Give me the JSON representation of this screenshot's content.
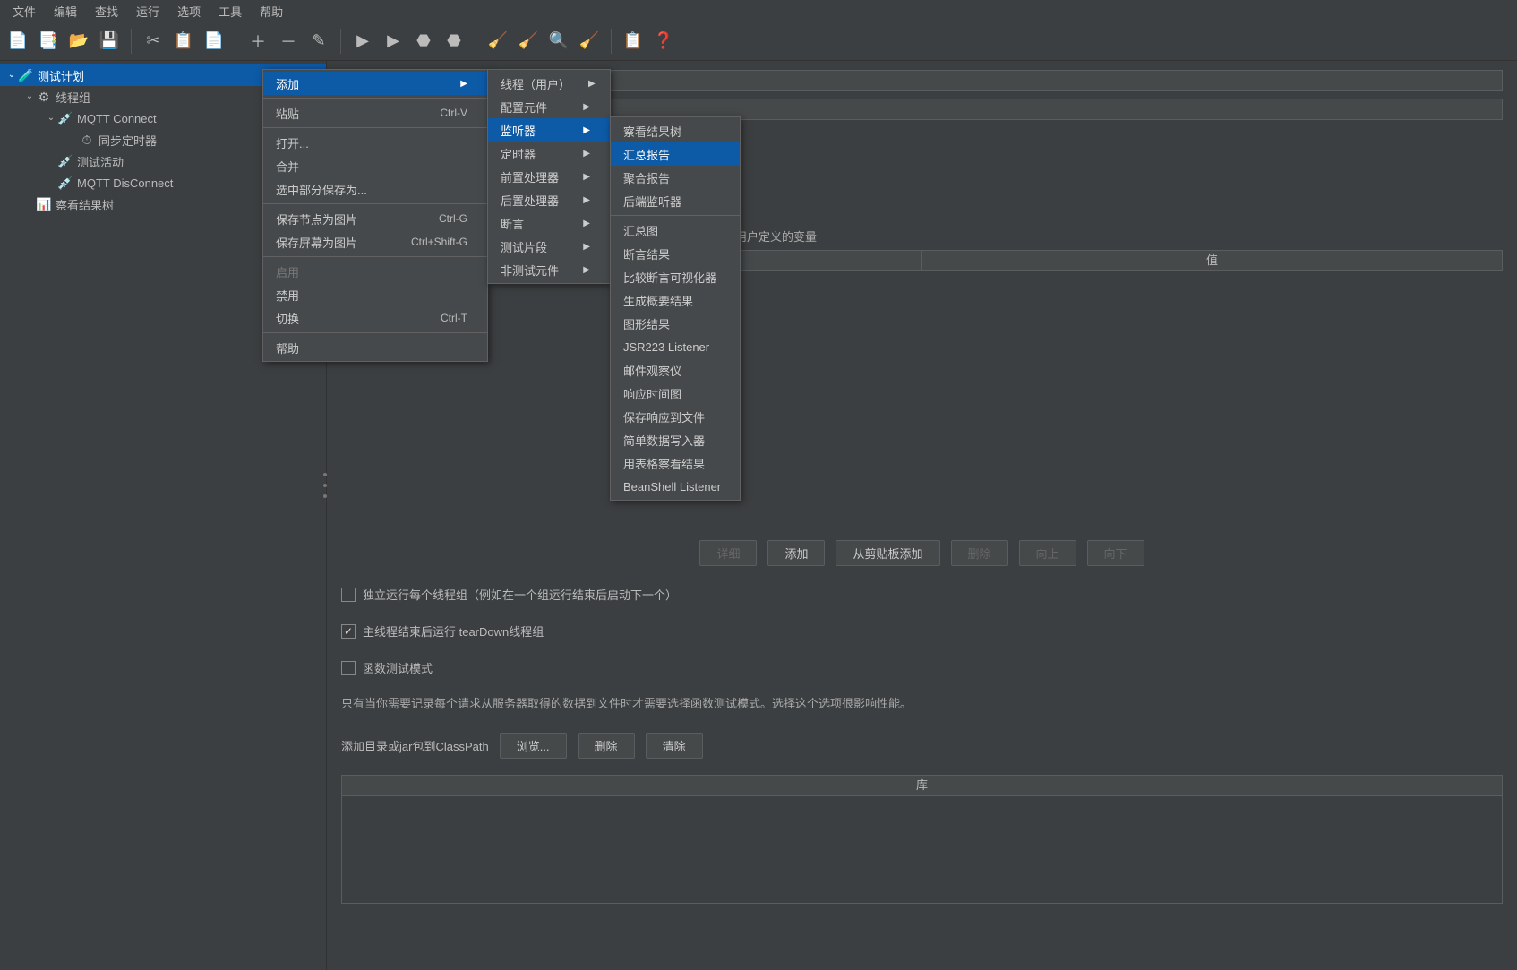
{
  "menubar": [
    "文件",
    "编辑",
    "查找",
    "运行",
    "选项",
    "工具",
    "帮助"
  ],
  "toolbar_icons": [
    {
      "name": "new-file-icon",
      "glyph": "📄"
    },
    {
      "name": "templates-icon",
      "glyph": "📑"
    },
    {
      "name": "open-icon",
      "glyph": "📂"
    },
    {
      "name": "save-icon",
      "glyph": "💾"
    },
    {
      "name": "sep"
    },
    {
      "name": "cut-icon",
      "glyph": "✂"
    },
    {
      "name": "copy-icon",
      "glyph": "📋"
    },
    {
      "name": "paste-icon",
      "glyph": "📄"
    },
    {
      "name": "sep"
    },
    {
      "name": "plus-icon",
      "glyph": "＋"
    },
    {
      "name": "minus-icon",
      "glyph": "－"
    },
    {
      "name": "wand-icon",
      "glyph": "✎"
    },
    {
      "name": "sep"
    },
    {
      "name": "run-icon",
      "glyph": "▶"
    },
    {
      "name": "run-remote-icon",
      "glyph": "▶"
    },
    {
      "name": "stop-icon",
      "glyph": "⬣"
    },
    {
      "name": "shutdown-icon",
      "glyph": "⬣"
    },
    {
      "name": "sep"
    },
    {
      "name": "clear-icon",
      "glyph": "🧹"
    },
    {
      "name": "clear-all-icon",
      "glyph": "🧹"
    },
    {
      "name": "search-icon",
      "glyph": "🔍"
    },
    {
      "name": "broom-icon",
      "glyph": "🧹"
    },
    {
      "name": "sep"
    },
    {
      "name": "func-icon",
      "glyph": "📋"
    },
    {
      "name": "help-icon",
      "glyph": "❓"
    }
  ],
  "tree": {
    "root": "测试计划",
    "thread_group": "线程组",
    "mqtt_connect": "MQTT Connect",
    "sync_timer": "同步定时器",
    "test_action": "测试活动",
    "mqtt_disconnect": "MQTT DisConnect",
    "view_results": "察看结果树"
  },
  "ctx1": {
    "add": "添加",
    "paste": "粘贴",
    "paste_sc": "Ctrl-V",
    "open": "打开...",
    "merge": "合并",
    "save_sel": "选中部分保存为...",
    "save_node_img": "保存节点为图片",
    "save_node_img_sc": "Ctrl-G",
    "save_screen_img": "保存屏幕为图片",
    "save_screen_img_sc": "Ctrl+Shift-G",
    "enable": "启用",
    "disable": "禁用",
    "toggle": "切换",
    "toggle_sc": "Ctrl-T",
    "help": "帮助"
  },
  "ctx2": {
    "threads": "线程（用户）",
    "config": "配置元件",
    "listener": "监听器",
    "timer": "定时器",
    "pre": "前置处理器",
    "post": "后置处理器",
    "assert": "断言",
    "fragment": "测试片段",
    "nontest": "非测试元件"
  },
  "ctx3": {
    "view_results_tree": "察看结果树",
    "summary_report": "汇总报告",
    "aggregate_report": "聚合报告",
    "backend_listener": "后端监听器",
    "aggregate_graph": "汇总图",
    "assertion_results": "断言结果",
    "compare_assert": "比较断言可视化器",
    "gen_summary": "生成概要结果",
    "graph_results": "图形结果",
    "jsr223": "JSR223 Listener",
    "mail_visualizer": "邮件观察仪",
    "response_time_graph": "响应时间图",
    "save_resp_file": "保存响应到文件",
    "simple_data_writer": "简单数据写入器",
    "view_results_table": "用表格察看结果",
    "beanshell": "BeanShell Listener"
  },
  "content": {
    "user_vars_label": "用户定义的变量",
    "value_header": "值",
    "btn_detail": "详细",
    "btn_add": "添加",
    "btn_add_clip": "从剪贴板添加",
    "btn_delete": "删除",
    "btn_up": "向上",
    "btn_down": "向下",
    "chk_serial": "独立运行每个线程组（例如在一个组运行结束后启动下一个）",
    "chk_teardown": "主线程结束后运行 tearDown线程组",
    "chk_functional": "函数测试模式",
    "func_note": "只有当你需要记录每个请求从服务器取得的数据到文件时才需要选择函数测试模式。选择这个选项很影响性能。",
    "classpath_label": "添加目录或jar包到ClassPath",
    "btn_browse": "浏览...",
    "btn_del2": "删除",
    "btn_clear": "清除",
    "lib_header": "库"
  }
}
